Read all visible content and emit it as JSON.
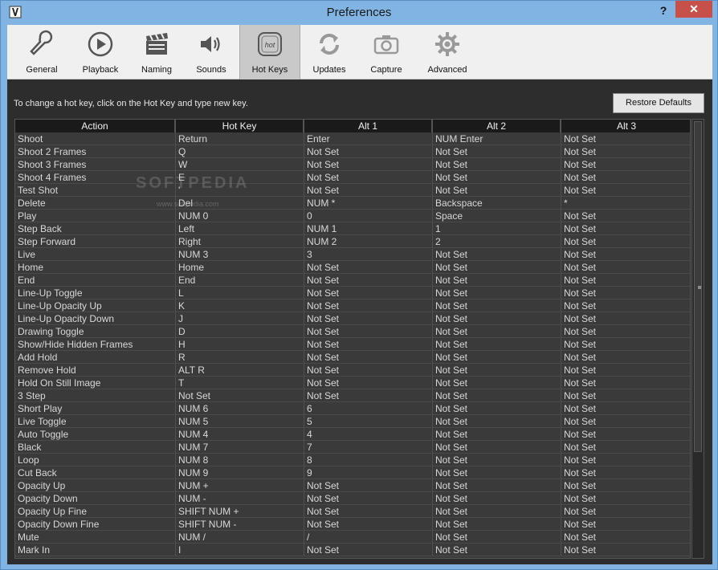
{
  "window": {
    "title": "Preferences",
    "help_label": "?",
    "close_label": "✕"
  },
  "tabs": [
    {
      "label": "General",
      "icon": "wrench-icon"
    },
    {
      "label": "Playback",
      "icon": "play-icon"
    },
    {
      "label": "Naming",
      "icon": "clapperboard-icon"
    },
    {
      "label": "Sounds",
      "icon": "speaker-icon"
    },
    {
      "label": "Hot Keys",
      "icon": "hotkey-icon",
      "active": true
    },
    {
      "label": "Updates",
      "icon": "refresh-icon"
    },
    {
      "label": "Capture",
      "icon": "camera-icon"
    },
    {
      "label": "Advanced",
      "icon": "gear-icon"
    }
  ],
  "hotkeys": {
    "hint": "To change a hot key, click on the Hot Key and type new key.",
    "restore_label": "Restore Defaults",
    "watermark": "SOFTPEDIA",
    "watermark_url": "www.softpedia.com",
    "columns": [
      "Action",
      "Hot Key",
      "Alt 1",
      "Alt 2",
      "Alt 3"
    ],
    "rows": [
      [
        "Shoot",
        "Return",
        "Enter",
        "NUM Enter",
        "Not Set"
      ],
      [
        "Shoot 2 Frames",
        "Q",
        "Not Set",
        "Not Set",
        "Not Set"
      ],
      [
        "Shoot 3 Frames",
        "W",
        "Not Set",
        "Not Set",
        "Not Set"
      ],
      [
        "Shoot 4 Frames",
        "E",
        "Not Set",
        "Not Set",
        "Not Set"
      ],
      [
        "Test Shot",
        "'",
        "Not Set",
        "Not Set",
        "Not Set"
      ],
      [
        "Delete",
        "Del",
        "NUM *",
        "Backspace",
        "*"
      ],
      [
        "Play",
        "NUM 0",
        "0",
        "Space",
        "Not Set"
      ],
      [
        "Step Back",
        "Left",
        "NUM 1",
        "1",
        "Not Set"
      ],
      [
        "Step Forward",
        "Right",
        "NUM 2",
        "2",
        "Not Set"
      ],
      [
        "Live",
        "NUM 3",
        "3",
        "Not Set",
        "Not Set"
      ],
      [
        "Home",
        "Home",
        "Not Set",
        "Not Set",
        "Not Set"
      ],
      [
        "End",
        "End",
        "Not Set",
        "Not Set",
        "Not Set"
      ],
      [
        "Line-Up Toggle",
        "L",
        "Not Set",
        "Not Set",
        "Not Set"
      ],
      [
        "Line-Up Opacity Up",
        "K",
        "Not Set",
        "Not Set",
        "Not Set"
      ],
      [
        "Line-Up Opacity Down",
        "J",
        "Not Set",
        "Not Set",
        "Not Set"
      ],
      [
        "Drawing Toggle",
        "D",
        "Not Set",
        "Not Set",
        "Not Set"
      ],
      [
        "Show/Hide Hidden Frames",
        "H",
        "Not Set",
        "Not Set",
        "Not Set"
      ],
      [
        "Add Hold",
        "R",
        "Not Set",
        "Not Set",
        "Not Set"
      ],
      [
        "Remove Hold",
        "ALT R",
        "Not Set",
        "Not Set",
        "Not Set"
      ],
      [
        "Hold On Still Image",
        "T",
        "Not Set",
        "Not Set",
        "Not Set"
      ],
      [
        "3 Step",
        "Not Set",
        "Not Set",
        "Not Set",
        "Not Set"
      ],
      [
        "Short Play",
        "NUM 6",
        "6",
        "Not Set",
        "Not Set"
      ],
      [
        "Live Toggle",
        "NUM 5",
        "5",
        "Not Set",
        "Not Set"
      ],
      [
        "Auto Toggle",
        "NUM 4",
        "4",
        "Not Set",
        "Not Set"
      ],
      [
        "Black",
        "NUM 7",
        "7",
        "Not Set",
        "Not Set"
      ],
      [
        "Loop",
        "NUM 8",
        "8",
        "Not Set",
        "Not Set"
      ],
      [
        "Cut Back",
        "NUM 9",
        "9",
        "Not Set",
        "Not Set"
      ],
      [
        "Opacity Up",
        "NUM +",
        "Not Set",
        "Not Set",
        "Not Set"
      ],
      [
        "Opacity Down",
        "NUM -",
        "Not Set",
        "Not Set",
        "Not Set"
      ],
      [
        "Opacity Up Fine",
        "SHIFT NUM +",
        "Not Set",
        "Not Set",
        "Not Set"
      ],
      [
        "Opacity Down Fine",
        "SHIFT NUM -",
        "Not Set",
        "Not Set",
        "Not Set"
      ],
      [
        "Mute",
        "NUM /",
        "/",
        "Not Set",
        "Not Set"
      ],
      [
        "Mark In",
        "I",
        "Not Set",
        "Not Set",
        "Not Set"
      ]
    ]
  },
  "colors": {
    "window_frame": "#82b4e3",
    "close_button": "#c7504b",
    "grid_bg": "#3a3a3a",
    "header_bg": "#1a1a1a"
  }
}
